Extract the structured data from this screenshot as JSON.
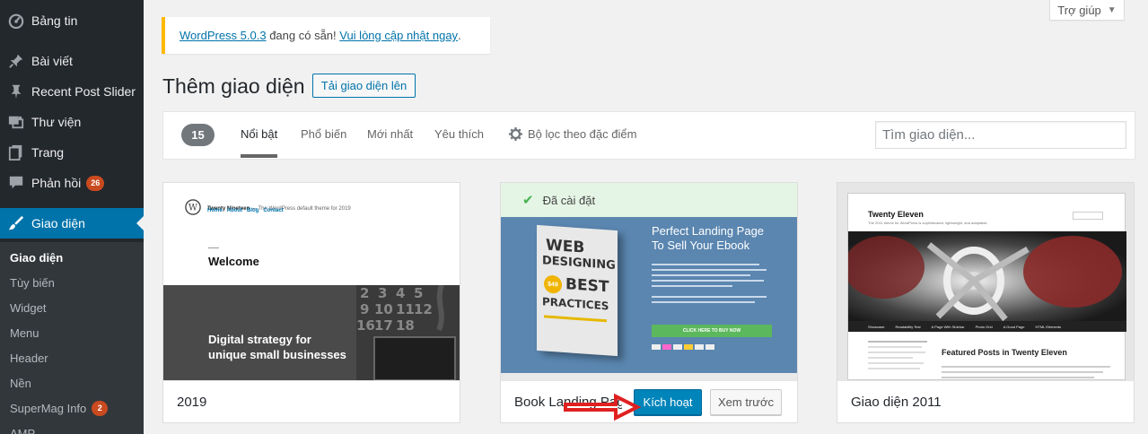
{
  "sidebar": {
    "items": [
      {
        "label": "Bảng tin",
        "icon": "dashboard-icon"
      },
      {
        "label": "Bài viết",
        "icon": "pin-icon"
      },
      {
        "label": "Recent Post Slider",
        "icon": "pin-icon"
      },
      {
        "label": "Thư viện",
        "icon": "media-icon"
      },
      {
        "label": "Trang",
        "icon": "page-icon"
      },
      {
        "label": "Phản hồi",
        "icon": "comment-icon",
        "badge": "26"
      },
      {
        "label": "Giao diện",
        "icon": "brush-icon",
        "current": true
      }
    ],
    "submenu": [
      {
        "label": "Giao diện",
        "current": true
      },
      {
        "label": "Tùy biến"
      },
      {
        "label": "Widget"
      },
      {
        "label": "Menu"
      },
      {
        "label": "Header"
      },
      {
        "label": "Nền"
      },
      {
        "label": "SuperMag Info",
        "badge": "2"
      },
      {
        "label": "AMP"
      }
    ]
  },
  "help_tab": {
    "label": "Trợ giúp"
  },
  "notice": {
    "version_link": "WordPress 5.0.3",
    "text": " đang có sẵn! ",
    "update_link": "Vui lòng cập nhật ngay",
    "end": "."
  },
  "header": {
    "title": "Thêm giao diện",
    "upload_label": "Tải giao diện lên"
  },
  "filter": {
    "count": "15",
    "tabs": [
      "Nổi bật",
      "Phổ biến",
      "Mới nhất",
      "Yêu thích"
    ],
    "feature_filter": "Bộ lọc theo đặc điểm",
    "search_placeholder": "Tìm giao diện..."
  },
  "themes": [
    {
      "name": "2019",
      "shot": {
        "site_title": "Twenty Nineteen",
        "tagline": " — The WordPress default theme for 2019",
        "nav": [
          "Home",
          "About",
          "Blog",
          "Contact"
        ],
        "welcome": "Welcome",
        "hero_line1": "Digital strategy for",
        "hero_line2": "unique small businesses"
      }
    },
    {
      "name": "Book Landing Page",
      "installed": "Đã cài đặt",
      "activate": "Kích hoạt",
      "preview": "Xem trước",
      "shot": {
        "headline1": "Perfect Landing Page",
        "headline2": "To Sell Your Ebook",
        "book_line1": "WEB",
        "book_line2": "DESIGNING",
        "book_price": "$49",
        "book_line3": "BEST",
        "book_line4": "PRACTICES",
        "cta": "CLICK HERE TO BUY NOW"
      }
    },
    {
      "name": "Giao diện 2011",
      "shot": {
        "site_title": "Twenty Eleven",
        "tagline": "The 2011 theme for WordPress is sophisticated, lightweight, and adaptable.",
        "featured": "Featured Posts in Twenty Eleven",
        "nav": [
          "Showcase",
          "Readability Test",
          "A Page With Sidebar",
          "Photo Grid",
          "A Good Page",
          "HTML Elements"
        ]
      }
    }
  ],
  "colors": {
    "sidebar": "#23282d",
    "accent": "#0073aa",
    "notice": "#ffb900",
    "badge": "#ca4a1f",
    "arrow": "#e02020"
  }
}
